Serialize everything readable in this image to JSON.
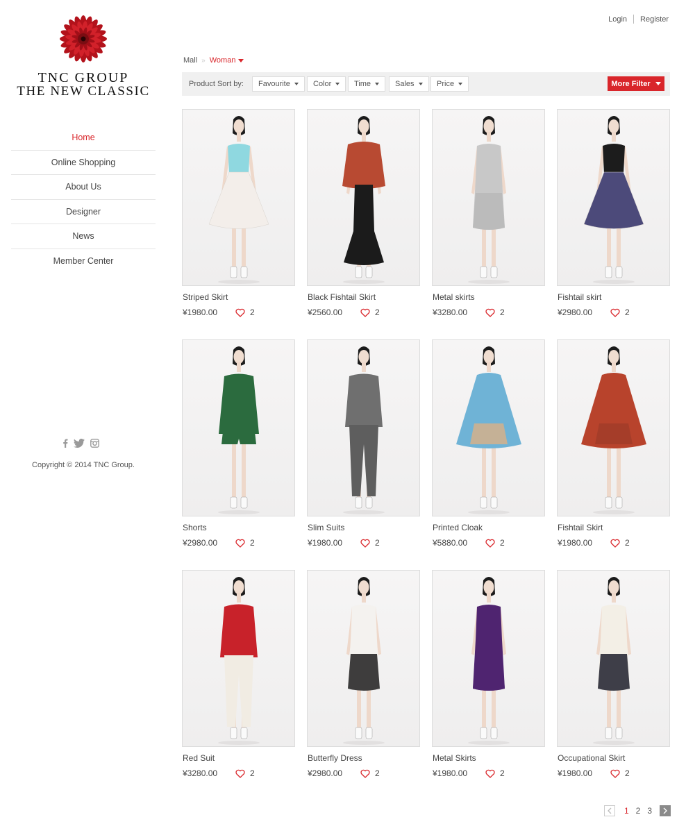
{
  "brand": {
    "line1": "TNC GROUP",
    "line2": "THE NEW CLASSIC",
    "accent": "#d9262b"
  },
  "nav": [
    {
      "label": "Home",
      "active": true
    },
    {
      "label": "Online Shopping"
    },
    {
      "label": "About Us"
    },
    {
      "label": "Designer"
    },
    {
      "label": "News"
    },
    {
      "label": "Member Center"
    }
  ],
  "social": [
    "facebook-icon",
    "twitter-icon",
    "instagram-icon"
  ],
  "copyright": "Copyright © 2014 TNC Group.",
  "auth": {
    "login": "Login",
    "register": "Register"
  },
  "breadcrumb": {
    "root": "Mall",
    "separator": "»",
    "current": "Woman"
  },
  "sort": {
    "label": "Product Sort by:",
    "options": [
      "Favourite",
      "Color",
      "Time",
      "Sales",
      "Price"
    ],
    "more": "More Filter"
  },
  "products": [
    {
      "name": "Striped Skirt",
      "price": "¥1980.00",
      "likes": "2",
      "top": "#8fd8e0",
      "bottom": "#f3eeea",
      "shape": "flare"
    },
    {
      "name": "Black Fishtail Skirt",
      "price": "¥2560.00",
      "likes": "2",
      "top": "#b84a32",
      "bottom": "#1b1b1b",
      "shape": "fishtail"
    },
    {
      "name": "Metal skirts",
      "price": "¥3280.00",
      "likes": "2",
      "top": "#c8c8c8",
      "bottom": "#b9b9b9",
      "shape": "dress"
    },
    {
      "name": "Fishtail skirt",
      "price": "¥2980.00",
      "likes": "2",
      "top": "#1c1c1c",
      "bottom": "#4c4a7a",
      "shape": "flare"
    },
    {
      "name": "Shorts",
      "price": "¥2980.00",
      "likes": "2",
      "top": "#2b6b3e",
      "bottom": "#2b6b3e",
      "shape": "shorts"
    },
    {
      "name": "Slim Suits",
      "price": "¥1980.00",
      "likes": "2",
      "top": "#6f6f6f",
      "bottom": "#5e5e5e",
      "shape": "pants"
    },
    {
      "name": "Printed Cloak",
      "price": "¥5880.00",
      "likes": "2",
      "top": "#6fb3d6",
      "bottom": "#e9b07a",
      "shape": "cloak"
    },
    {
      "name": "Fishtail Skirt",
      "price": "¥1980.00",
      "likes": "2",
      "top": "#b8432c",
      "bottom": "#9c3a28",
      "shape": "cloak"
    },
    {
      "name": "Red Suit",
      "price": "¥3280.00",
      "likes": "2",
      "top": "#c8222a",
      "bottom": "#f1ece3",
      "shape": "pants"
    },
    {
      "name": "Butterfly Dress",
      "price": "¥2980.00",
      "likes": "2",
      "top": "#f4f2ef",
      "bottom": "#1d1d1d",
      "shape": "dress"
    },
    {
      "name": "Metal Skirts",
      "price": "¥1980.00",
      "likes": "2",
      "top": "#4f2470",
      "bottom": "#4f2470",
      "shape": "dress"
    },
    {
      "name": "Occupational Skirt",
      "price": "¥1980.00",
      "likes": "2",
      "top": "#f3efe6",
      "bottom": "#1d1f2b",
      "shape": "dress"
    }
  ],
  "pagination": {
    "pages": [
      "1",
      "2",
      "3"
    ],
    "current": "1"
  }
}
